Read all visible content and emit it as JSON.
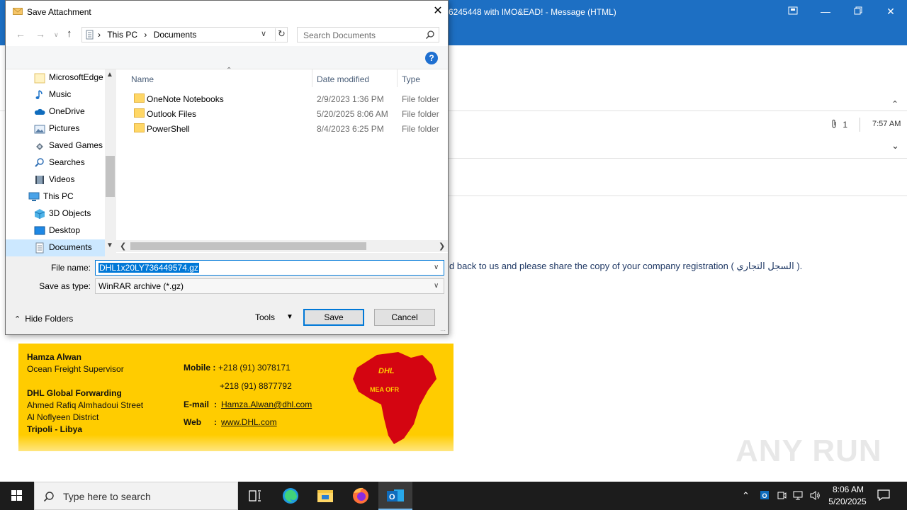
{
  "outlook": {
    "window_title": "6245448 with IMO&EAD!  -  Message (HTML)",
    "attachment_count": "1",
    "time": "7:57 AM",
    "body_text": "d back to us and please share the copy of your company registration ( السجل التجاري ).",
    "colors": {
      "titlebar": "#1d6fc3"
    }
  },
  "signature": {
    "name": "Hamza Alwan",
    "role": "Ocean Freight Supervisor",
    "company": "DHL Global Forwarding",
    "address1": "Ahmed Rafiq Almhadoui Street",
    "address2": "Al Noflyeen District",
    "city": "Tripoli - Libya",
    "mobile_label": "Mobile :",
    "mobile1": "+218 (91) 3078171",
    "mobile2": "+218 (91) 8877792",
    "email_label": "E-mail",
    "email_sep": ":",
    "email": "Hamza.Alwan@dhl.com",
    "web_label": "Web",
    "web_sep": ":",
    "web": "www.DHL.com",
    "logo_text": "DHL",
    "logo_subtext": "MEA OFR",
    "colors": {
      "card": "#ffcc00",
      "logo_red": "#d40511"
    }
  },
  "dialog": {
    "title": "Save Attachment",
    "close_label": "✕",
    "breadcrumb": [
      "This PC",
      "Documents"
    ],
    "search_placeholder": "Search Documents",
    "help_label": "?",
    "nav_items": [
      {
        "label": "MicrosoftEdge",
        "icon": "folder-icon"
      },
      {
        "label": "Music",
        "icon": "music-icon"
      },
      {
        "label": "OneDrive",
        "icon": "cloud-icon"
      },
      {
        "label": "Pictures",
        "icon": "pictures-icon"
      },
      {
        "label": "Saved Games",
        "icon": "saved-games-icon"
      },
      {
        "label": "Searches",
        "icon": "search-icon"
      },
      {
        "label": "Videos",
        "icon": "video-icon"
      },
      {
        "label": "This PC",
        "icon": "computer-icon"
      },
      {
        "label": "3D Objects",
        "icon": "cube-icon"
      },
      {
        "label": "Desktop",
        "icon": "desktop-icon"
      },
      {
        "label": "Documents",
        "icon": "documents-icon",
        "selected": true
      }
    ],
    "columns": {
      "name": "Name",
      "date": "Date modified",
      "type": "Type"
    },
    "files": [
      {
        "name": "OneNote Notebooks",
        "date": "2/9/2023 1:36 PM",
        "type": "File folder"
      },
      {
        "name": "Outlook Files",
        "date": "5/20/2025 8:06 AM",
        "type": "File folder"
      },
      {
        "name": "PowerShell",
        "date": "8/4/2023 6:25 PM",
        "type": "File folder"
      }
    ],
    "file_name_label": "File name:",
    "file_name_value": "DHL1x20LY736449574.gz",
    "save_type_label": "Save as type:",
    "save_type_value": "WinRAR archive (*.gz)",
    "hide_folders_label": "Hide Folders",
    "tools_label": "Tools",
    "save_label": "Save",
    "cancel_label": "Cancel",
    "colors": {
      "selection": "#0078d7",
      "nav_selected": "#cce8ff",
      "folder": "#ffd766"
    }
  },
  "watermark": "ANY RUN",
  "taskbar": {
    "search_placeholder": "Type here to search",
    "apps": [
      "task-view-icon",
      "edge-icon",
      "file-explorer-icon",
      "firefox-icon",
      "outlook-icon"
    ],
    "clock_time": "8:06 AM",
    "clock_date": "5/20/2025"
  }
}
